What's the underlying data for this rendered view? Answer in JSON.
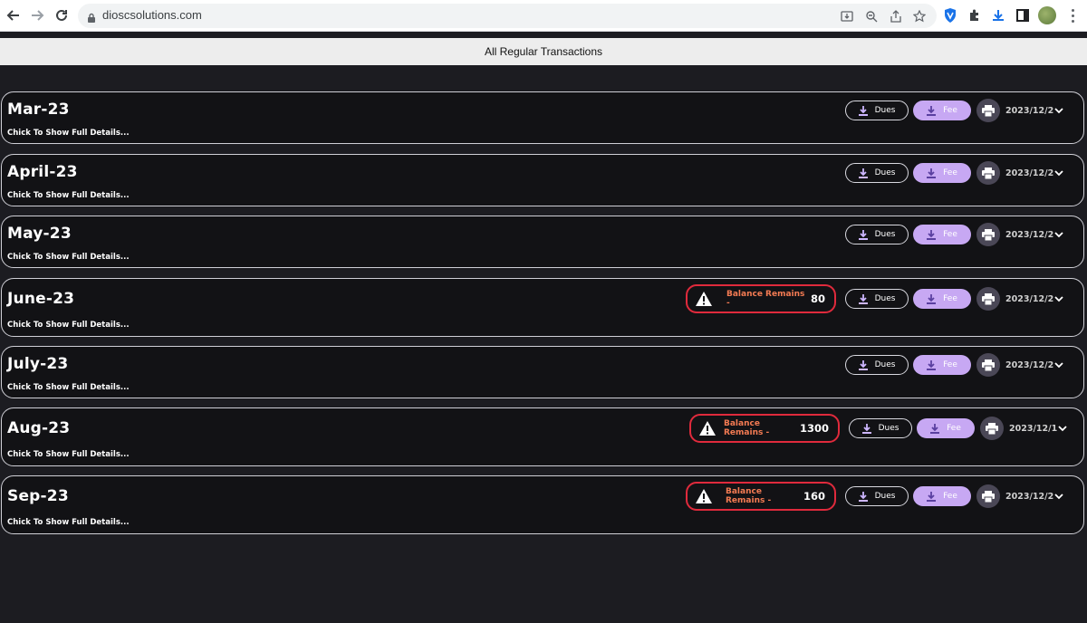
{
  "browser": {
    "url": "dioscsolutions.com"
  },
  "page": {
    "title": "All Regular Transactions"
  },
  "labels": {
    "dues": "Dues",
    "fee": "Fee",
    "details": "Chick To Show Full Details...",
    "balance_prefix": "Balance Remains -"
  },
  "rows": [
    {
      "month": "Mar-23",
      "date": "2023/12/2",
      "balance": null
    },
    {
      "month": "April-23",
      "date": "2023/12/2",
      "balance": null
    },
    {
      "month": "May-23",
      "date": "2023/12/2",
      "balance": null
    },
    {
      "month": "June-23",
      "date": "2023/12/2",
      "balance": "80"
    },
    {
      "month": "July-23",
      "date": "2023/12/2",
      "balance": null
    },
    {
      "month": "Aug-23",
      "date": "2023/12/1",
      "balance": "1300"
    },
    {
      "month": "Sep-23",
      "date": "2023/12/2",
      "balance": "160"
    }
  ],
  "colors": {
    "page_bg": "#1c1c21",
    "card_bg": "#121215",
    "fee_button": "#c7a8f3",
    "balance_border": "#e02a3c",
    "balance_text": "#f47b53"
  }
}
